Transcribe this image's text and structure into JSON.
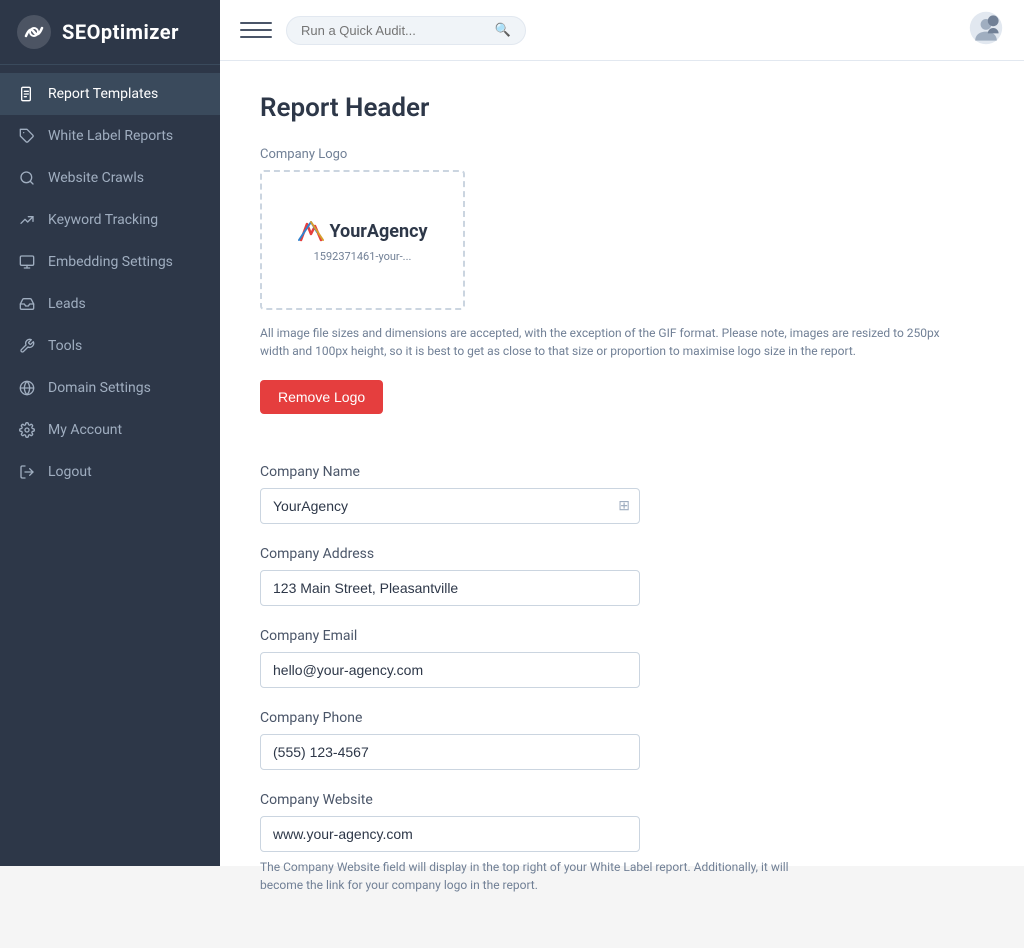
{
  "brand": {
    "name": "SEOptimizer"
  },
  "topbar": {
    "search_placeholder": "Run a Quick Audit...",
    "menu_label": "Menu"
  },
  "sidebar": {
    "items": [
      {
        "id": "report-templates",
        "label": "Report Templates",
        "icon": "file-text",
        "active": true
      },
      {
        "id": "white-label-reports",
        "label": "White Label Reports",
        "icon": "tag"
      },
      {
        "id": "website-crawls",
        "label": "Website Crawls",
        "icon": "search"
      },
      {
        "id": "keyword-tracking",
        "label": "Keyword Tracking",
        "icon": "edit"
      },
      {
        "id": "embedding-settings",
        "label": "Embedding Settings",
        "icon": "monitor"
      },
      {
        "id": "leads",
        "label": "Leads",
        "icon": "inbox"
      },
      {
        "id": "tools",
        "label": "Tools",
        "icon": "tool"
      },
      {
        "id": "domain-settings",
        "label": "Domain Settings",
        "icon": "globe"
      },
      {
        "id": "my-account",
        "label": "My Account",
        "icon": "settings"
      },
      {
        "id": "logout",
        "label": "Logout",
        "icon": "log-out"
      }
    ]
  },
  "page": {
    "title": "Report Header",
    "logo_section_label": "Company Logo",
    "logo_filename": "1592371461-your-...",
    "logo_info_text": "All image file sizes and dimensions are accepted, with the exception of the GIF format. Please note, images are resized to 250px width and 100px height, so it is best to get as close to that size or proportion to maximise logo size in the report.",
    "remove_logo_label": "Remove Logo",
    "fields": [
      {
        "id": "company-name",
        "label": "Company Name",
        "value": "YourAgency",
        "placeholder": "YourAgency"
      },
      {
        "id": "company-address",
        "label": "Company Address",
        "value": "123 Main Street, Pleasantville",
        "placeholder": ""
      },
      {
        "id": "company-email",
        "label": "Company Email",
        "value": "hello@your-agency.com",
        "placeholder": ""
      },
      {
        "id": "company-phone",
        "label": "Company Phone",
        "value": "(555) 123-4567",
        "placeholder": ""
      },
      {
        "id": "company-website",
        "label": "Company Website",
        "value": "www.your-agency.com",
        "placeholder": ""
      }
    ],
    "website_footer_note": "The Company Website field will display in the top right of your White Label report. Additionally, it will become the link for your company logo in the report."
  }
}
